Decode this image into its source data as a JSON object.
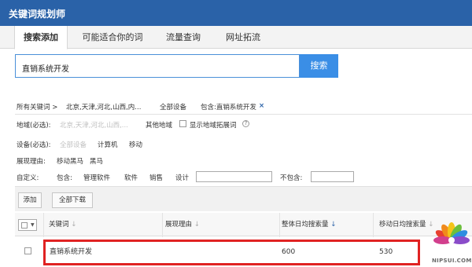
{
  "app": {
    "title": "关键词规划师"
  },
  "tabs": [
    {
      "label": "搜索添加"
    },
    {
      "label": "可能适合你的词"
    },
    {
      "label": "流量查询"
    },
    {
      "label": "网址拓流"
    }
  ],
  "search": {
    "value": "直销系统开发",
    "button_label": "搜索"
  },
  "breadcrumb": {
    "all": "所有关键词 >",
    "region": "北京,天津,河北,山西,内...",
    "device": "全部设备",
    "include": "包含:直销系统开发",
    "close": "×"
  },
  "filters": {
    "region_label": "地域(必选):",
    "region_value": "北京,天津,河北,山西,...",
    "other_region": "其他地域",
    "show_expand": "显示地域拓展词",
    "help": "?",
    "device_label": "设备(必选):",
    "device_options": [
      "全部设备",
      "计算机",
      "移动"
    ],
    "reason_label": "展现理由:",
    "reason_options": [
      "移动黑马",
      "黑马"
    ],
    "custom_label": "自定义:",
    "include_label": "包含:",
    "include_tags": [
      "管理软件",
      "软件",
      "销售",
      "设计"
    ],
    "exclude_label": "不包含:"
  },
  "toolbar": {
    "add_label": "添加",
    "download_label": "全部下载"
  },
  "table": {
    "columns": [
      {
        "label": "关键词",
        "sort": "↓",
        "sort_active": false
      },
      {
        "label": "展现理由",
        "sort": "↓",
        "sort_active": false
      },
      {
        "label": "整体日均搜索量",
        "sort": "↓",
        "sort_active": true
      },
      {
        "label": "移动日均搜索量",
        "sort": "↓",
        "sort_active": false
      }
    ],
    "rows": [
      {
        "keyword": "直销系统开发",
        "reason": "",
        "daily": "600",
        "mobile": "530"
      }
    ]
  },
  "watermark": {
    "text": "NIPSUI.COM"
  },
  "colors": {
    "title_bar": "#2a62a8",
    "search_button": "#3a8ee6",
    "highlight_border": "#e02222",
    "sorted_column": "#eef3fc"
  }
}
